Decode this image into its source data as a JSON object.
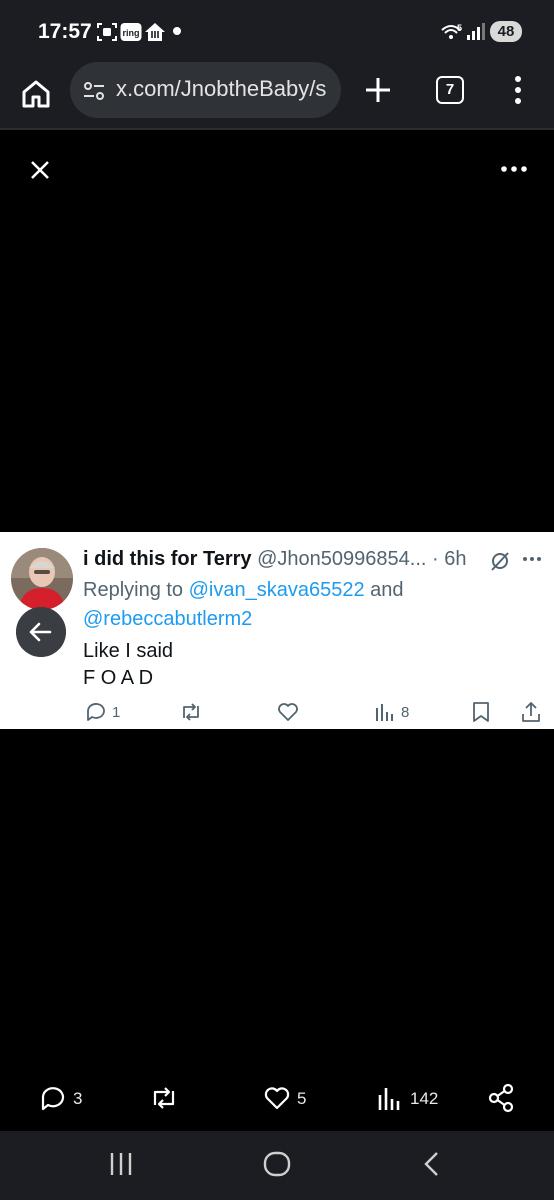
{
  "status_bar": {
    "time": "17:57",
    "notification_icons": [
      "screenshot-icon",
      "ring-icon",
      "food-delivery-icon"
    ],
    "signal_icons": [
      "wifi-5g-icon",
      "signal-icon"
    ],
    "battery": "48"
  },
  "browser": {
    "url": "x.com/JnobtheBaby/s",
    "tab_count": "7"
  },
  "tweet": {
    "name": "i did this for Terry",
    "handle": "@Jhon50996854...",
    "separator": " · ",
    "time": "6h",
    "replying_prefix": "Replying to ",
    "reply_user_1": "@ivan_skava65522",
    "reply_and": " and",
    "reply_user_2": "@rebeccabutlerm2",
    "text_line_1": "Like I said",
    "text_line_2": "F O A D",
    "reply_count": "1",
    "view_count": "8"
  },
  "bottom_actions": {
    "reply_count": "3",
    "like_count": "5",
    "view_count": "142"
  },
  "colors": {
    "link": "#1d9bf0",
    "secondary_text": "#536471",
    "chrome_bg": "#1b1d22"
  }
}
